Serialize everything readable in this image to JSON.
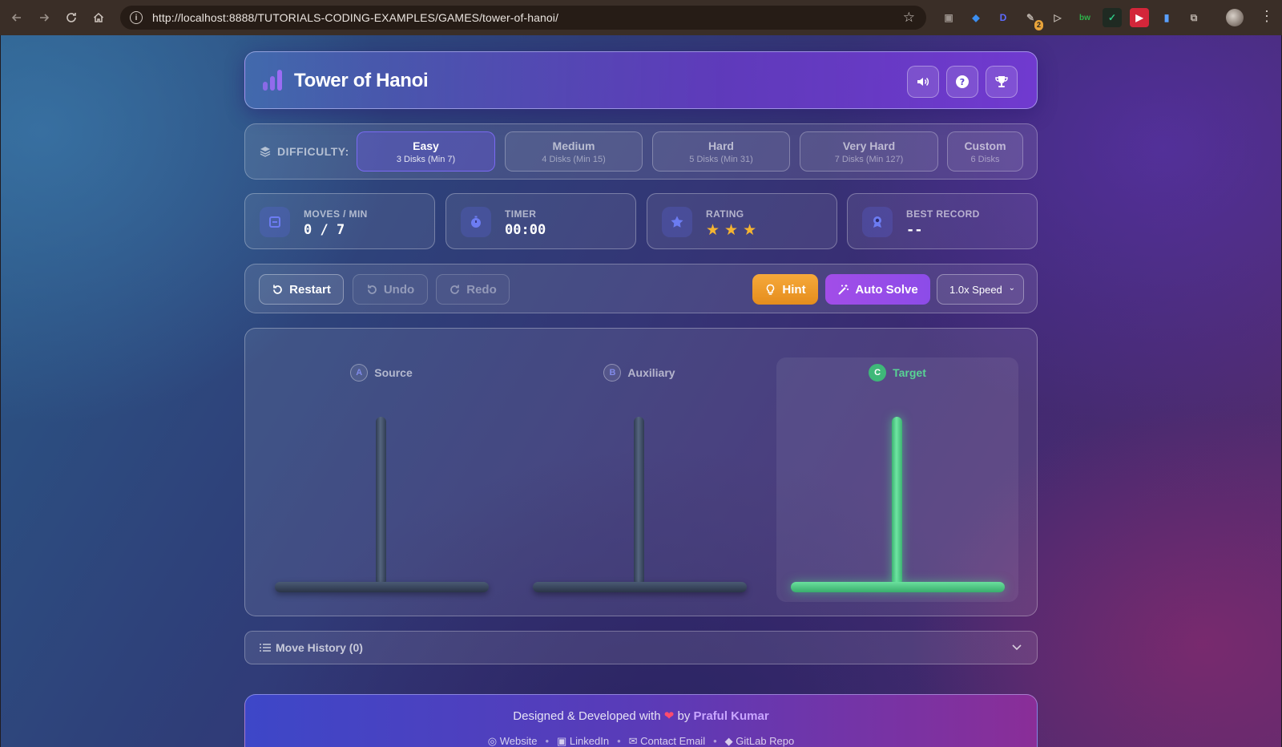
{
  "browser": {
    "url": "http://localhost:8888/TUTORIALS-CODING-EXAMPLES/GAMES/tower-of-hanoi/",
    "extension_badge": "2"
  },
  "header": {
    "title": "Tower of Hanoi",
    "buttons": [
      "sound-icon",
      "help-icon",
      "trophy-icon"
    ]
  },
  "difficulty": {
    "label": "DIFFICULTY:",
    "options": [
      {
        "name": "Easy",
        "sub": "3 Disks (Min 7)",
        "active": true
      },
      {
        "name": "Medium",
        "sub": "4 Disks (Min 15)"
      },
      {
        "name": "Hard",
        "sub": "5 Disks (Min 31)"
      },
      {
        "name": "Very Hard",
        "sub": "7 Disks (Min 127)"
      },
      {
        "name": "Custom",
        "sub": "6 Disks"
      }
    ]
  },
  "stats": {
    "moves": {
      "label": "MOVES / MIN",
      "value": "0 / 7"
    },
    "timer": {
      "label": "TIMER",
      "value": "00:00"
    },
    "rating": {
      "label": "RATING",
      "stars": 3
    },
    "best": {
      "label": "BEST RECORD",
      "value": "--"
    }
  },
  "controls": {
    "restart": "Restart",
    "undo": "Undo",
    "redo": "Redo",
    "hint": "Hint",
    "auto_solve": "Auto Solve",
    "speed": "1.0x Speed"
  },
  "towers": [
    {
      "letter": "A",
      "name": "Source"
    },
    {
      "letter": "B",
      "name": "Auxiliary"
    },
    {
      "letter": "C",
      "name": "Target"
    }
  ],
  "history": {
    "title": "Move History (0)"
  },
  "footer": {
    "prefix": "Designed & Developed with",
    "by": "by",
    "author": "Praful Kumar",
    "links": [
      "Website",
      "LinkedIn",
      "Contact Email",
      "GitLab Repo"
    ]
  },
  "colors": {
    "accent": "#9b6cf4",
    "hint": "#f6a93a",
    "auto_solve": "#a24de8",
    "target": "#3fb879",
    "star": "#f5b431"
  }
}
